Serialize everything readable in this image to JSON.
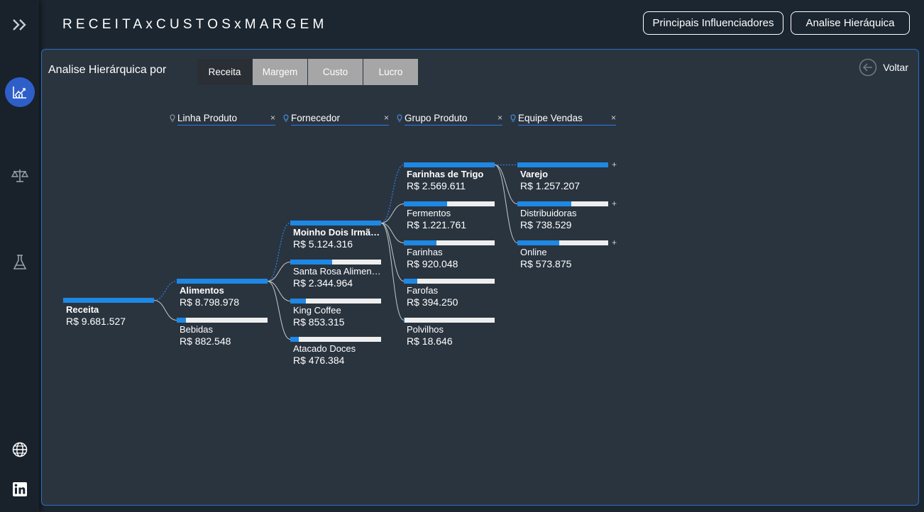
{
  "app": {
    "title": "RECEITAxCUSTOSxMARGEM"
  },
  "header": {
    "buttons": [
      {
        "label": "Principais Influenciadores"
      },
      {
        "label": "Analise Hieráquica"
      }
    ]
  },
  "sidebar": {
    "items": [
      {
        "icon": "double-chevron-right-icon",
        "active": false
      },
      {
        "icon": "line-chart-icon",
        "active": true
      },
      {
        "icon": "scales-icon",
        "active": false
      },
      {
        "icon": "flask-icon",
        "active": false
      },
      {
        "icon": "globe-icon",
        "active": false
      },
      {
        "icon": "linkedin-icon",
        "active": false
      }
    ]
  },
  "panel": {
    "title": "Analise Hierárquica por",
    "back_label": "Voltar",
    "measures": [
      {
        "label": "Receita",
        "active": true
      },
      {
        "label": "Margem",
        "active": false
      },
      {
        "label": "Custo",
        "active": false
      },
      {
        "label": "Lucro",
        "active": false
      }
    ],
    "levels": [
      {
        "label": "Linha Produto"
      },
      {
        "label": "Fornecedor"
      },
      {
        "label": "Grupo Produto"
      },
      {
        "label": "Equipe Vendas"
      }
    ],
    "colors": {
      "bar_fill": "#1e88e5",
      "bar_track": "#eeeeee",
      "accent": "#2c7be5"
    }
  },
  "tree": {
    "root": {
      "label": "Receita",
      "value": "R$ 9.681.527",
      "share": 1.0
    },
    "columns": [
      [
        {
          "label": "Alimentos",
          "value": "R$ 8.798.978",
          "share": 1.0,
          "selected": true
        },
        {
          "label": "Bebidas",
          "value": "R$ 882.548",
          "share": 0.1,
          "selected": false
        }
      ],
      [
        {
          "label": "Moinho Dois Irmãos",
          "value": "R$ 5.124.316",
          "share": 1.0,
          "selected": true
        },
        {
          "label": "Santa Rosa Alimentos",
          "value": "R$ 2.344.964",
          "share": 0.46,
          "selected": false
        },
        {
          "label": "King Coffee",
          "value": "R$ 853.315",
          "share": 0.17,
          "selected": false
        },
        {
          "label": "Atacado Doces",
          "value": "R$ 476.384",
          "share": 0.09,
          "selected": false
        }
      ],
      [
        {
          "label": "Farinhas de Trigo",
          "value": "R$ 2.569.611",
          "share": 1.0,
          "selected": true
        },
        {
          "label": "Fermentos",
          "value": "R$ 1.221.761",
          "share": 0.48,
          "selected": false
        },
        {
          "label": "Farinhas",
          "value": "R$ 920.048",
          "share": 0.36,
          "selected": false
        },
        {
          "label": "Farofas",
          "value": "R$ 394.250",
          "share": 0.15,
          "selected": false
        },
        {
          "label": "Polvilhos",
          "value": "R$ 18.646",
          "share": 0.01,
          "selected": false
        }
      ],
      [
        {
          "label": "Varejo",
          "value": "R$ 1.257.207",
          "share": 1.0,
          "selected": true,
          "expandable": "+"
        },
        {
          "label": "Distribuidoras",
          "value": "R$ 738.529",
          "share": 0.59,
          "selected": false,
          "expandable": "+"
        },
        {
          "label": "Online",
          "value": "R$ 573.875",
          "share": 0.46,
          "selected": false,
          "expandable": "+"
        }
      ]
    ]
  }
}
